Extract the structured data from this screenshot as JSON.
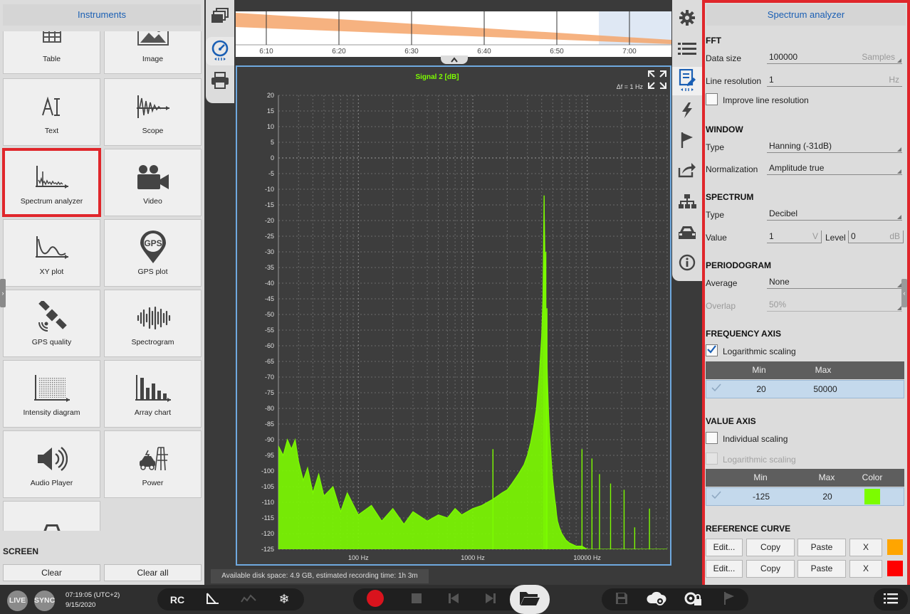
{
  "left_panel": {
    "title": "Instruments",
    "tiles": [
      {
        "label": "Table",
        "icon": "table-icon"
      },
      {
        "label": "Image",
        "icon": "image-icon"
      },
      {
        "label": "Text",
        "icon": "text-icon"
      },
      {
        "label": "Scope",
        "icon": "scope-icon"
      },
      {
        "label": "Spectrum analyzer",
        "icon": "spectrum-analyzer-icon"
      },
      {
        "label": "Video",
        "icon": "video-camera-icon"
      },
      {
        "label": "XY plot",
        "icon": "xy-plot-icon"
      },
      {
        "label": "GPS plot",
        "icon": "gps-pin-icon",
        "icon_text": "GPS"
      },
      {
        "label": "GPS quality",
        "icon": "satellite-icon"
      },
      {
        "label": "Spectrogram",
        "icon": "spectrogram-icon"
      },
      {
        "label": "Intensity diagram",
        "icon": "intensity-diagram-icon"
      },
      {
        "label": "Array chart",
        "icon": "array-chart-icon"
      },
      {
        "label": "Audio Player",
        "icon": "speaker-icon"
      },
      {
        "label": "Power",
        "icon": "power-icon"
      },
      {
        "label": "",
        "icon": "car-icon"
      }
    ],
    "screen_section": "SCREEN",
    "clear_label": "Clear",
    "clear_all_label": "Clear all"
  },
  "overview": {
    "time_ticks": [
      "6:10",
      "6:20",
      "6:30",
      "6:40",
      "6:50",
      "7:00"
    ]
  },
  "chart_data": {
    "type": "line",
    "title": "Signal 2 [dB]",
    "annotation": "Δf = 1 Hz",
    "xscale": "log",
    "xlim": [
      20,
      50000
    ],
    "ylim": [
      -125,
      20
    ],
    "yticks": [
      20,
      15,
      10,
      5,
      0,
      -5,
      -10,
      -15,
      -20,
      -25,
      -30,
      -35,
      -40,
      -45,
      -50,
      -55,
      -60,
      -65,
      -70,
      -75,
      -80,
      -85,
      -90,
      -95,
      -100,
      -105,
      -110,
      -115,
      -120,
      -125
    ],
    "xticks": [
      {
        "value": 100,
        "label": "100 Hz"
      },
      {
        "value": 1000,
        "label": "1000 Hz"
      },
      {
        "value": 10000,
        "label": "10000 Hz"
      }
    ],
    "grid": true,
    "series_color": "#7cfc00",
    "series": [
      {
        "x": [
          20,
          22,
          24,
          26,
          28,
          30,
          33,
          36,
          40,
          45,
          50,
          60,
          70,
          80,
          100,
          130,
          160,
          200,
          250,
          300,
          400,
          500,
          600,
          700,
          800,
          1000,
          1200,
          1500,
          1800,
          2000,
          2200,
          2500,
          2800,
          3000,
          3200,
          3400,
          3600,
          3800,
          4000,
          4100,
          4200,
          4300,
          4400,
          4500,
          4600,
          4700,
          4800,
          4900,
          5000,
          5100,
          5200,
          5300,
          5400,
          5500,
          5700,
          6000,
          6500,
          7000,
          8000,
          9000,
          10000,
          12000,
          15000,
          20000,
          30000,
          50000
        ],
        "y": [
          -92,
          -95,
          -90,
          -93,
          -90,
          -97,
          -103,
          -99,
          -107,
          -101,
          -108,
          -105,
          -113,
          -107,
          -114,
          -111,
          -116,
          -112,
          -117,
          -113,
          -116,
          -114,
          -115,
          -112,
          -114,
          -112,
          -111,
          -109,
          -107,
          -106,
          -104,
          -101,
          -98,
          -95,
          -91,
          -86,
          -80,
          -70,
          -57,
          -45,
          -13,
          -40,
          -58,
          -72,
          -82,
          -89,
          -94,
          -99,
          -103,
          -106,
          -109,
          -111,
          -114,
          -116,
          -118,
          -120,
          -122,
          -123,
          -124,
          -124,
          -125,
          -125,
          -125,
          -125,
          -125,
          -125
        ]
      }
    ],
    "spikes": [
      {
        "x": 4200,
        "y": -12
      },
      {
        "x": 4350,
        "y": -30
      },
      {
        "x": 4450,
        "y": -48
      },
      {
        "x": 1500,
        "y": -93
      },
      {
        "x": 9000,
        "y": -93
      },
      {
        "x": 11000,
        "y": -96
      },
      {
        "x": 12800,
        "y": -101
      },
      {
        "x": 16000,
        "y": -104
      },
      {
        "x": 21000,
        "y": -106
      },
      {
        "x": 26000,
        "y": -118
      },
      {
        "x": 35000,
        "y": -112
      }
    ]
  },
  "status": {
    "disk_space": "Available disk space: 4.9 GB, estimated recording time: 1h 3m"
  },
  "right_panel": {
    "title": "Spectrum analyzer",
    "fft": {
      "section": "FFT",
      "data_size_label": "Data size",
      "data_size_value": "100000",
      "data_size_unit": "Samples",
      "line_res_label": "Line resolution",
      "line_res_value": "1",
      "line_res_unit": "Hz",
      "improve_label": "Improve line resolution"
    },
    "window": {
      "section": "WINDOW",
      "type_label": "Type",
      "type_value": "Hanning (-31dB)",
      "norm_label": "Normalization",
      "norm_value": "Amplitude true"
    },
    "spectrum": {
      "section": "SPECTRUM",
      "type_label": "Type",
      "type_value": "Decibel",
      "value_label": "Value",
      "value_value": "1",
      "value_unit": "V",
      "level_label": "Level",
      "level_value": "0",
      "level_unit": "dB"
    },
    "periodogram": {
      "section": "PERIODOGRAM",
      "average_label": "Average",
      "average_value": "None",
      "overlap_label": "Overlap",
      "overlap_value": "50%"
    },
    "frequency_axis": {
      "section": "FREQUENCY AXIS",
      "log_label": "Logarithmic scaling",
      "log_checked": true,
      "min_header": "Min",
      "max_header": "Max",
      "min_value": "20",
      "max_value": "50000"
    },
    "value_axis": {
      "section": "VALUE AXIS",
      "individual_label": "Individual scaling",
      "log_label": "Logarithmic scaling",
      "min_header": "Min",
      "max_header": "Max",
      "color_header": "Color",
      "min_value": "-125",
      "max_value": "20",
      "color": "#7cfc00"
    },
    "reference_curve": {
      "section": "REFERENCE CURVE",
      "rows": [
        {
          "edit": "Edit...",
          "copy": "Copy",
          "paste": "Paste",
          "x": "X",
          "color": "#ffa500"
        },
        {
          "edit": "Edit...",
          "copy": "Copy",
          "paste": "Paste",
          "x": "X",
          "color": "#ff0000"
        }
      ]
    }
  },
  "bottom_bar": {
    "live": "LIVE",
    "sync": "SYNC",
    "time": "07:19:05 (UTC+2)",
    "date": "9/15/2020",
    "rc": "RC"
  }
}
